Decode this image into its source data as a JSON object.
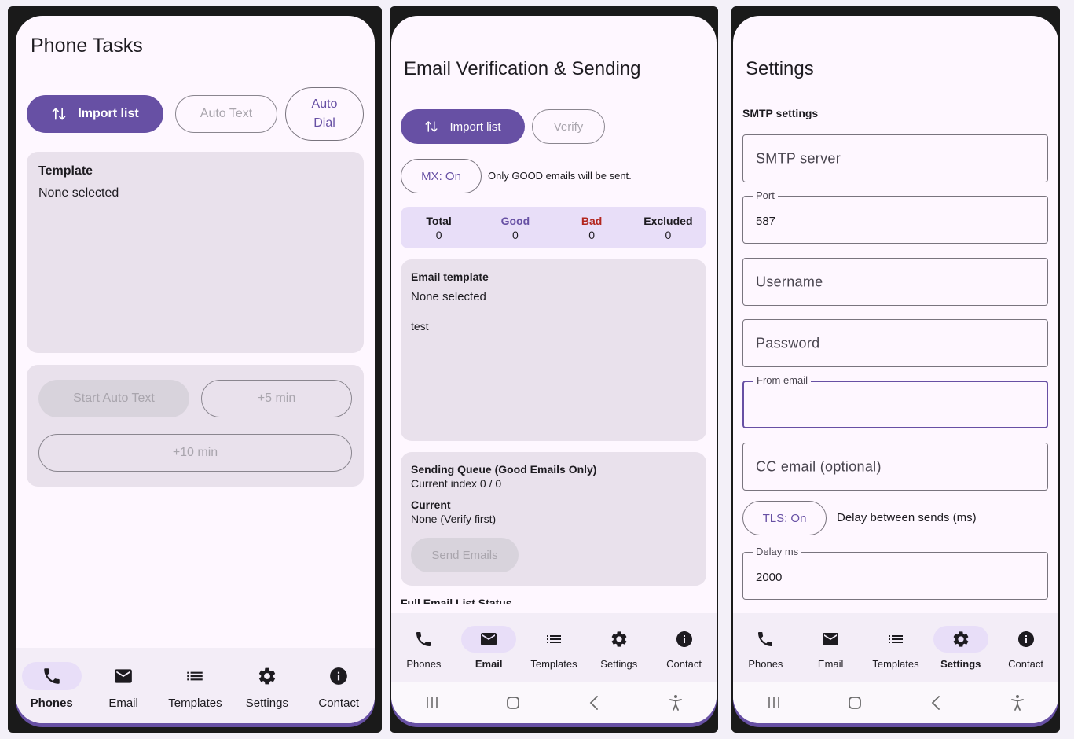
{
  "phones_screen": {
    "title": "Phone Tasks",
    "import_button": "Import list",
    "auto_text_button": "Auto Text",
    "auto_dial_line1": "Auto",
    "auto_dial_line2": "Dial",
    "template_label": "Template",
    "template_value": "None selected",
    "start_auto_text": "Start Auto Text",
    "plus5": "+5 min",
    "plus10": "+10 min"
  },
  "email_screen": {
    "title": "Email Verification & Sending",
    "import_button": "Import list",
    "verify_button": "Verify",
    "mx_button": "MX: On",
    "mx_note": "Only GOOD emails will be sent.",
    "stats": [
      {
        "label": "Total",
        "value": "0",
        "color": "#1d1b20"
      },
      {
        "label": "Good",
        "value": "0",
        "color": "#6750a4"
      },
      {
        "label": "Bad",
        "value": "0",
        "color": "#b3261e"
      },
      {
        "label": "Excluded",
        "value": "0",
        "color": "#1d1b20"
      }
    ],
    "template_label": "Email template",
    "template_value": "None selected",
    "template_item": "test",
    "queue_label": "Sending Queue (Good Emails Only)",
    "queue_index": "Current index 0 / 0",
    "current_label": "Current",
    "current_value": "None (Verify first)",
    "send_button": "Send Emails",
    "list_status": "Full Email List Status"
  },
  "settings_screen": {
    "title": "Settings",
    "section": "SMTP settings",
    "smtp_server_placeholder": "SMTP server",
    "port_label": "Port",
    "port_value": "587",
    "username_placeholder": "Username",
    "password_placeholder": "Password",
    "from_email_label": "From email",
    "cc_placeholder": "CC email (optional)",
    "tls_button": "TLS: On",
    "delay_text": "Delay between sends (ms)",
    "delay_label": "Delay ms",
    "delay_value": "2000"
  },
  "nav": {
    "phones": "Phones",
    "email": "Email",
    "templates": "Templates",
    "settings": "Settings",
    "contact": "Contact"
  },
  "colors": {
    "primary": "#6750a4",
    "bad": "#b3261e",
    "card": "#e9e1ec",
    "stats_bg": "#e8def8"
  }
}
